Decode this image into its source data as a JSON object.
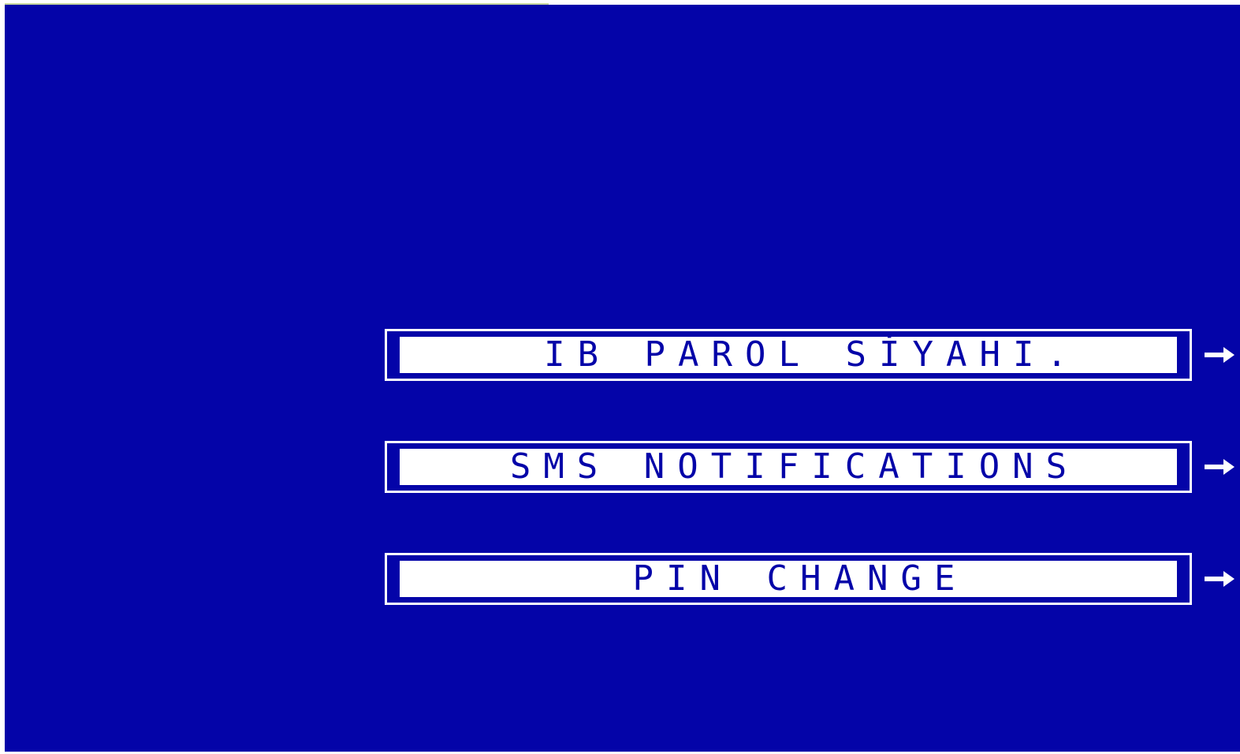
{
  "colors": {
    "background": "#0404A8",
    "option_fill": "#ffffff",
    "option_text": "#0404A8"
  },
  "menu": {
    "options": [
      {
        "label": "IB PAROL SİYAHI.",
        "arrow_icon": "arrow-right-icon"
      },
      {
        "label": "SMS NOTIFICATIONS",
        "arrow_icon": "arrow-right-icon"
      },
      {
        "label": "PIN CHANGE",
        "arrow_icon": "arrow-right-icon"
      }
    ]
  }
}
